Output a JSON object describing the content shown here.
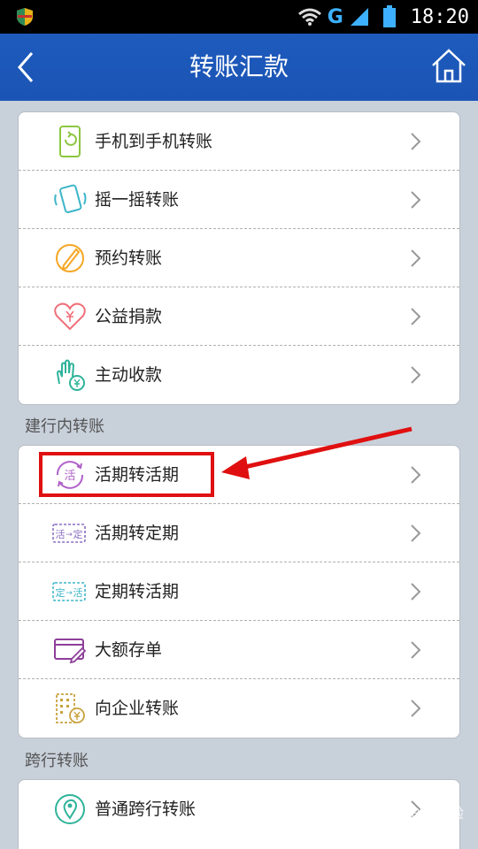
{
  "status_bar": {
    "network": "G",
    "time": "18:20"
  },
  "header": {
    "title": "转账汇款"
  },
  "group1": {
    "items": [
      {
        "label": "手机到手机转账",
        "icon": "phone-refresh-icon"
      },
      {
        "label": "摇一摇转账",
        "icon": "shake-phone-icon"
      },
      {
        "label": "预约转账",
        "icon": "pencil-clock-icon"
      },
      {
        "label": "公益捐款",
        "icon": "heart-yuan-icon"
      },
      {
        "label": "主动收款",
        "icon": "hand-yuan-icon"
      }
    ]
  },
  "section_internal": {
    "title": "建行内转账"
  },
  "group2": {
    "items": [
      {
        "label": "活期转活期",
        "icon": "cycle-huo-icon",
        "icon_text": "活"
      },
      {
        "label": "活期转定期",
        "icon": "huo-to-ding-icon",
        "icon_text_a": "活",
        "icon_text_b": "定"
      },
      {
        "label": "定期转活期",
        "icon": "ding-to-huo-icon",
        "icon_text_a": "定",
        "icon_text_b": "活"
      },
      {
        "label": "大额存单",
        "icon": "card-pen-icon"
      },
      {
        "label": "向企业转账",
        "icon": "building-yuan-icon"
      }
    ]
  },
  "section_interbank": {
    "title": "跨行转账"
  },
  "group3": {
    "items": [
      {
        "label": "普通跨行转账",
        "icon": "location-pin-icon"
      }
    ]
  },
  "watermark": "Bai 经验",
  "colors": {
    "header": "#1d5bbd",
    "highlight": "#e01010"
  }
}
